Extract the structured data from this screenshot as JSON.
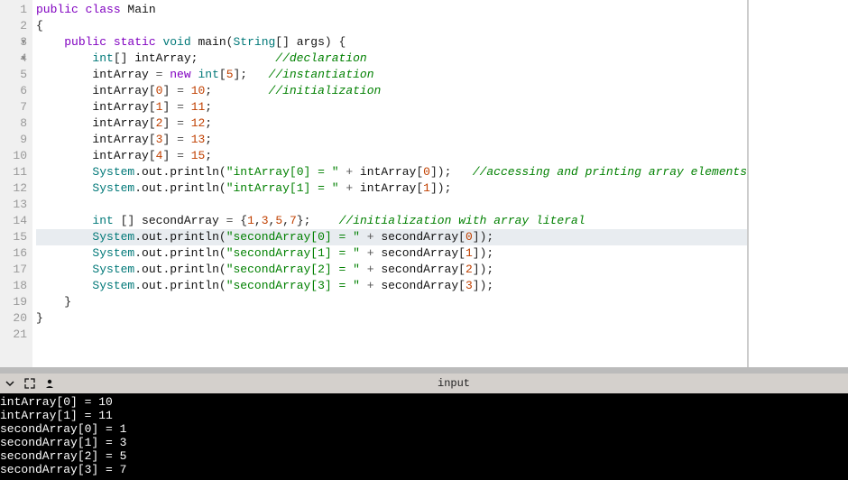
{
  "editor": {
    "highlighted_line": 15,
    "fold_markers": [
      2,
      3
    ],
    "lines": [
      {
        "n": 1,
        "tokens": [
          [
            "kw",
            "public "
          ],
          [
            "kw",
            "class "
          ],
          [
            "cls",
            "Main"
          ]
        ]
      },
      {
        "n": 2,
        "tokens": [
          [
            "punc",
            "{"
          ]
        ]
      },
      {
        "n": 3,
        "tokens": [
          [
            "plain",
            "    "
          ],
          [
            "kw",
            "public "
          ],
          [
            "kw",
            "static "
          ],
          [
            "type",
            "void "
          ],
          [
            "id",
            "main"
          ],
          [
            "punc",
            "("
          ],
          [
            "type",
            "String"
          ],
          [
            "punc",
            "[] "
          ],
          [
            "id",
            "args"
          ],
          [
            "punc",
            ") {"
          ]
        ]
      },
      {
        "n": 4,
        "tokens": [
          [
            "plain",
            "        "
          ],
          [
            "type",
            "int"
          ],
          [
            "punc",
            "[] "
          ],
          [
            "id",
            "intArray"
          ],
          [
            "punc",
            ";           "
          ],
          [
            "cmt",
            "//declaration"
          ]
        ]
      },
      {
        "n": 5,
        "tokens": [
          [
            "plain",
            "        "
          ],
          [
            "id",
            "intArray "
          ],
          [
            "op",
            "= "
          ],
          [
            "kw",
            "new "
          ],
          [
            "type",
            "int"
          ],
          [
            "punc",
            "["
          ],
          [
            "num",
            "5"
          ],
          [
            "punc",
            "];   "
          ],
          [
            "cmt",
            "//instantiation"
          ]
        ]
      },
      {
        "n": 6,
        "tokens": [
          [
            "plain",
            "        "
          ],
          [
            "id",
            "intArray"
          ],
          [
            "punc",
            "["
          ],
          [
            "num",
            "0"
          ],
          [
            "punc",
            "] "
          ],
          [
            "op",
            "= "
          ],
          [
            "num",
            "10"
          ],
          [
            "punc",
            ";        "
          ],
          [
            "cmt",
            "//initialization"
          ]
        ]
      },
      {
        "n": 7,
        "tokens": [
          [
            "plain",
            "        "
          ],
          [
            "id",
            "intArray"
          ],
          [
            "punc",
            "["
          ],
          [
            "num",
            "1"
          ],
          [
            "punc",
            "] "
          ],
          [
            "op",
            "= "
          ],
          [
            "num",
            "11"
          ],
          [
            "punc",
            ";"
          ]
        ]
      },
      {
        "n": 8,
        "tokens": [
          [
            "plain",
            "        "
          ],
          [
            "id",
            "intArray"
          ],
          [
            "punc",
            "["
          ],
          [
            "num",
            "2"
          ],
          [
            "punc",
            "] "
          ],
          [
            "op",
            "= "
          ],
          [
            "num",
            "12"
          ],
          [
            "punc",
            ";"
          ]
        ]
      },
      {
        "n": 9,
        "tokens": [
          [
            "plain",
            "        "
          ],
          [
            "id",
            "intArray"
          ],
          [
            "punc",
            "["
          ],
          [
            "num",
            "3"
          ],
          [
            "punc",
            "] "
          ],
          [
            "op",
            "= "
          ],
          [
            "num",
            "13"
          ],
          [
            "punc",
            ";"
          ]
        ]
      },
      {
        "n": 10,
        "tokens": [
          [
            "plain",
            "        "
          ],
          [
            "id",
            "intArray"
          ],
          [
            "punc",
            "["
          ],
          [
            "num",
            "4"
          ],
          [
            "punc",
            "] "
          ],
          [
            "op",
            "= "
          ],
          [
            "num",
            "15"
          ],
          [
            "punc",
            ";"
          ]
        ]
      },
      {
        "n": 11,
        "tokens": [
          [
            "plain",
            "        "
          ],
          [
            "type",
            "System"
          ],
          [
            "punc",
            "."
          ],
          [
            "id",
            "out"
          ],
          [
            "punc",
            "."
          ],
          [
            "id",
            "println"
          ],
          [
            "punc",
            "("
          ],
          [
            "str",
            "\"intArray[0] = \""
          ],
          [
            "op",
            " + "
          ],
          [
            "id",
            "intArray"
          ],
          [
            "punc",
            "["
          ],
          [
            "num",
            "0"
          ],
          [
            "punc",
            "]);   "
          ],
          [
            "cmt",
            "//accessing and printing array elements"
          ]
        ]
      },
      {
        "n": 12,
        "tokens": [
          [
            "plain",
            "        "
          ],
          [
            "type",
            "System"
          ],
          [
            "punc",
            "."
          ],
          [
            "id",
            "out"
          ],
          [
            "punc",
            "."
          ],
          [
            "id",
            "println"
          ],
          [
            "punc",
            "("
          ],
          [
            "str",
            "\"intArray[1] = \""
          ],
          [
            "op",
            " + "
          ],
          [
            "id",
            "intArray"
          ],
          [
            "punc",
            "["
          ],
          [
            "num",
            "1"
          ],
          [
            "punc",
            "]);"
          ]
        ]
      },
      {
        "n": 13,
        "tokens": []
      },
      {
        "n": 14,
        "tokens": [
          [
            "plain",
            "        "
          ],
          [
            "type",
            "int "
          ],
          [
            "punc",
            "[] "
          ],
          [
            "id",
            "secondArray "
          ],
          [
            "op",
            "= "
          ],
          [
            "punc",
            "{"
          ],
          [
            "num",
            "1"
          ],
          [
            "punc",
            ","
          ],
          [
            "num",
            "3"
          ],
          [
            "punc",
            ","
          ],
          [
            "num",
            "5"
          ],
          [
            "punc",
            ","
          ],
          [
            "num",
            "7"
          ],
          [
            "punc",
            "};    "
          ],
          [
            "cmt",
            "//initialization with array literal"
          ]
        ]
      },
      {
        "n": 15,
        "tokens": [
          [
            "plain",
            "        "
          ],
          [
            "type",
            "System"
          ],
          [
            "punc",
            "."
          ],
          [
            "id",
            "out"
          ],
          [
            "punc",
            "."
          ],
          [
            "id",
            "println"
          ],
          [
            "punc",
            "("
          ],
          [
            "str",
            "\"secondArray[0] = \""
          ],
          [
            "op",
            " + "
          ],
          [
            "id",
            "secondArray"
          ],
          [
            "punc",
            "["
          ],
          [
            "num",
            "0"
          ],
          [
            "punc",
            "]);"
          ]
        ]
      },
      {
        "n": 16,
        "tokens": [
          [
            "plain",
            "        "
          ],
          [
            "type",
            "System"
          ],
          [
            "punc",
            "."
          ],
          [
            "id",
            "out"
          ],
          [
            "punc",
            "."
          ],
          [
            "id",
            "println"
          ],
          [
            "punc",
            "("
          ],
          [
            "str",
            "\"secondArray[1] = \""
          ],
          [
            "op",
            " + "
          ],
          [
            "id",
            "secondArray"
          ],
          [
            "punc",
            "["
          ],
          [
            "num",
            "1"
          ],
          [
            "punc",
            "]);"
          ]
        ]
      },
      {
        "n": 17,
        "tokens": [
          [
            "plain",
            "        "
          ],
          [
            "type",
            "System"
          ],
          [
            "punc",
            "."
          ],
          [
            "id",
            "out"
          ],
          [
            "punc",
            "."
          ],
          [
            "id",
            "println"
          ],
          [
            "punc",
            "("
          ],
          [
            "str",
            "\"secondArray[2] = \""
          ],
          [
            "op",
            " + "
          ],
          [
            "id",
            "secondArray"
          ],
          [
            "punc",
            "["
          ],
          [
            "num",
            "2"
          ],
          [
            "punc",
            "]);"
          ]
        ]
      },
      {
        "n": 18,
        "tokens": [
          [
            "plain",
            "        "
          ],
          [
            "type",
            "System"
          ],
          [
            "punc",
            "."
          ],
          [
            "id",
            "out"
          ],
          [
            "punc",
            "."
          ],
          [
            "id",
            "println"
          ],
          [
            "punc",
            "("
          ],
          [
            "str",
            "\"secondArray[3] = \""
          ],
          [
            "op",
            " + "
          ],
          [
            "id",
            "secondArray"
          ],
          [
            "punc",
            "["
          ],
          [
            "num",
            "3"
          ],
          [
            "punc",
            "]);"
          ]
        ]
      },
      {
        "n": 19,
        "tokens": [
          [
            "plain",
            "    "
          ],
          [
            "punc",
            "}"
          ]
        ]
      },
      {
        "n": 20,
        "tokens": [
          [
            "punc",
            "}"
          ]
        ]
      },
      {
        "n": 21,
        "tokens": []
      }
    ]
  },
  "toolbar": {
    "input_label": "input"
  },
  "console": {
    "lines": [
      "intArray[0] = 10",
      "intArray[1] = 11",
      "secondArray[0] = 1",
      "secondArray[1] = 3",
      "secondArray[2] = 5",
      "secondArray[3] = 7"
    ]
  }
}
